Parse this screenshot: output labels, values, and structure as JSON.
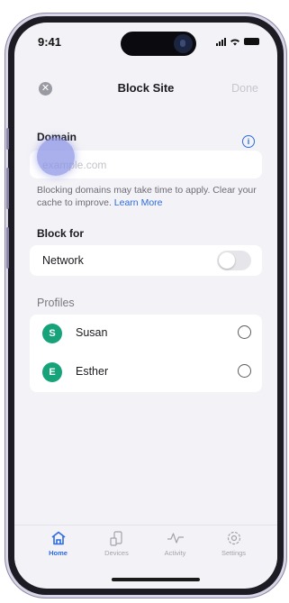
{
  "status": {
    "time": "9:41"
  },
  "header": {
    "title": "Block Site",
    "done_label": "Done",
    "close_glyph": "✕"
  },
  "domain": {
    "label": "Domain",
    "placeholder": "example.com",
    "hint": "Blocking domains may take time to apply. Clear your cache to improve.",
    "learn_more": "Learn More"
  },
  "block_for": {
    "label": "Block for",
    "network_label": "Network",
    "network_enabled": false
  },
  "profiles": {
    "label": "Profiles",
    "items": [
      {
        "initial": "S",
        "name": "Susan",
        "selected": false
      },
      {
        "initial": "E",
        "name": "Esther",
        "selected": false
      }
    ]
  },
  "tabs": [
    {
      "label": "Home",
      "icon": "home-icon",
      "active": true
    },
    {
      "label": "Devices",
      "icon": "devices-icon",
      "active": false
    },
    {
      "label": "Activity",
      "icon": "activity-icon",
      "active": false
    },
    {
      "label": "Settings",
      "icon": "settings-icon",
      "active": false
    }
  ],
  "colors": {
    "accent": "#2d6be0",
    "avatar": "#17a37a"
  }
}
